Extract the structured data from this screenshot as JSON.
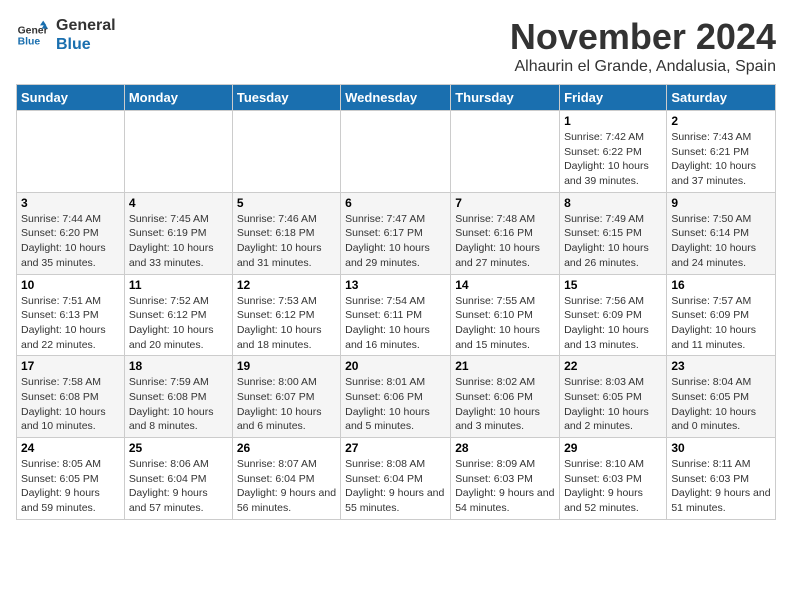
{
  "logo": {
    "line1": "General",
    "line2": "Blue"
  },
  "title": "November 2024",
  "subtitle": "Alhaurin el Grande, Andalusia, Spain",
  "days_of_week": [
    "Sunday",
    "Monday",
    "Tuesday",
    "Wednesday",
    "Thursday",
    "Friday",
    "Saturday"
  ],
  "weeks": [
    [
      {
        "day": "",
        "content": ""
      },
      {
        "day": "",
        "content": ""
      },
      {
        "day": "",
        "content": ""
      },
      {
        "day": "",
        "content": ""
      },
      {
        "day": "",
        "content": ""
      },
      {
        "day": "1",
        "content": "Sunrise: 7:42 AM\nSunset: 6:22 PM\nDaylight: 10 hours and 39 minutes."
      },
      {
        "day": "2",
        "content": "Sunrise: 7:43 AM\nSunset: 6:21 PM\nDaylight: 10 hours and 37 minutes."
      }
    ],
    [
      {
        "day": "3",
        "content": "Sunrise: 7:44 AM\nSunset: 6:20 PM\nDaylight: 10 hours and 35 minutes."
      },
      {
        "day": "4",
        "content": "Sunrise: 7:45 AM\nSunset: 6:19 PM\nDaylight: 10 hours and 33 minutes."
      },
      {
        "day": "5",
        "content": "Sunrise: 7:46 AM\nSunset: 6:18 PM\nDaylight: 10 hours and 31 minutes."
      },
      {
        "day": "6",
        "content": "Sunrise: 7:47 AM\nSunset: 6:17 PM\nDaylight: 10 hours and 29 minutes."
      },
      {
        "day": "7",
        "content": "Sunrise: 7:48 AM\nSunset: 6:16 PM\nDaylight: 10 hours and 27 minutes."
      },
      {
        "day": "8",
        "content": "Sunrise: 7:49 AM\nSunset: 6:15 PM\nDaylight: 10 hours and 26 minutes."
      },
      {
        "day": "9",
        "content": "Sunrise: 7:50 AM\nSunset: 6:14 PM\nDaylight: 10 hours and 24 minutes."
      }
    ],
    [
      {
        "day": "10",
        "content": "Sunrise: 7:51 AM\nSunset: 6:13 PM\nDaylight: 10 hours and 22 minutes."
      },
      {
        "day": "11",
        "content": "Sunrise: 7:52 AM\nSunset: 6:12 PM\nDaylight: 10 hours and 20 minutes."
      },
      {
        "day": "12",
        "content": "Sunrise: 7:53 AM\nSunset: 6:12 PM\nDaylight: 10 hours and 18 minutes."
      },
      {
        "day": "13",
        "content": "Sunrise: 7:54 AM\nSunset: 6:11 PM\nDaylight: 10 hours and 16 minutes."
      },
      {
        "day": "14",
        "content": "Sunrise: 7:55 AM\nSunset: 6:10 PM\nDaylight: 10 hours and 15 minutes."
      },
      {
        "day": "15",
        "content": "Sunrise: 7:56 AM\nSunset: 6:09 PM\nDaylight: 10 hours and 13 minutes."
      },
      {
        "day": "16",
        "content": "Sunrise: 7:57 AM\nSunset: 6:09 PM\nDaylight: 10 hours and 11 minutes."
      }
    ],
    [
      {
        "day": "17",
        "content": "Sunrise: 7:58 AM\nSunset: 6:08 PM\nDaylight: 10 hours and 10 minutes."
      },
      {
        "day": "18",
        "content": "Sunrise: 7:59 AM\nSunset: 6:08 PM\nDaylight: 10 hours and 8 minutes."
      },
      {
        "day": "19",
        "content": "Sunrise: 8:00 AM\nSunset: 6:07 PM\nDaylight: 10 hours and 6 minutes."
      },
      {
        "day": "20",
        "content": "Sunrise: 8:01 AM\nSunset: 6:06 PM\nDaylight: 10 hours and 5 minutes."
      },
      {
        "day": "21",
        "content": "Sunrise: 8:02 AM\nSunset: 6:06 PM\nDaylight: 10 hours and 3 minutes."
      },
      {
        "day": "22",
        "content": "Sunrise: 8:03 AM\nSunset: 6:05 PM\nDaylight: 10 hours and 2 minutes."
      },
      {
        "day": "23",
        "content": "Sunrise: 8:04 AM\nSunset: 6:05 PM\nDaylight: 10 hours and 0 minutes."
      }
    ],
    [
      {
        "day": "24",
        "content": "Sunrise: 8:05 AM\nSunset: 6:05 PM\nDaylight: 9 hours and 59 minutes."
      },
      {
        "day": "25",
        "content": "Sunrise: 8:06 AM\nSunset: 6:04 PM\nDaylight: 9 hours and 57 minutes."
      },
      {
        "day": "26",
        "content": "Sunrise: 8:07 AM\nSunset: 6:04 PM\nDaylight: 9 hours and 56 minutes."
      },
      {
        "day": "27",
        "content": "Sunrise: 8:08 AM\nSunset: 6:04 PM\nDaylight: 9 hours and 55 minutes."
      },
      {
        "day": "28",
        "content": "Sunrise: 8:09 AM\nSunset: 6:03 PM\nDaylight: 9 hours and 54 minutes."
      },
      {
        "day": "29",
        "content": "Sunrise: 8:10 AM\nSunset: 6:03 PM\nDaylight: 9 hours and 52 minutes."
      },
      {
        "day": "30",
        "content": "Sunrise: 8:11 AM\nSunset: 6:03 PM\nDaylight: 9 hours and 51 minutes."
      }
    ]
  ]
}
